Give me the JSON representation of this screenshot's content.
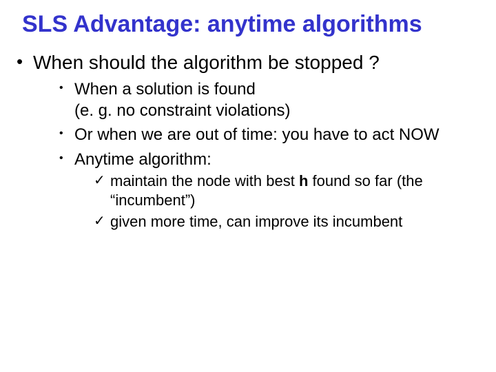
{
  "title": "SLS Advantage: anytime algorithms",
  "l1": {
    "item1": "When should the algorithm be  stopped ?"
  },
  "l2": {
    "item1_line1": "When  a  solution is found",
    "item1_line2": "(e. g. no constraint violations)",
    "item2": "Or when we are out of time: you have to act NOW",
    "item3": "Anytime algorithm:"
  },
  "l3": {
    "item1_pre": "maintain the node with best ",
    "item1_h": "h",
    "item1_post": " found so far (the “incumbent”)",
    "item2": "given more time, can improve its incumbent"
  },
  "check": "✓"
}
